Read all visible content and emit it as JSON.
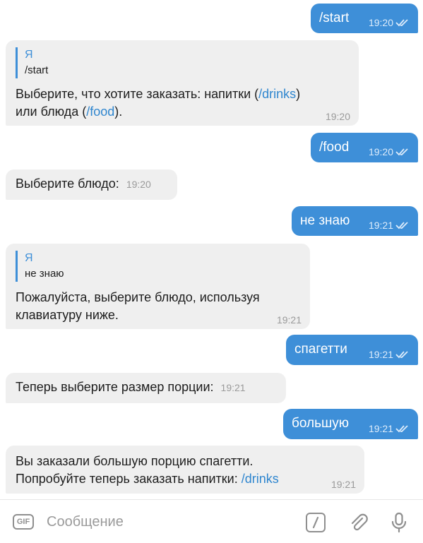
{
  "messages": [
    {
      "side": "out",
      "text": "/start",
      "time": "19:20"
    },
    {
      "side": "in",
      "reply_name": "Я",
      "reply_text": "/start",
      "text_a": "Выберите, что хотите заказать: напитки (",
      "cmd_a": "/drinks",
      "text_b": ")",
      "text_c": "или блюда (",
      "cmd_b": "/food",
      "text_d": ").",
      "time": "19:20"
    },
    {
      "side": "out",
      "text": "/food",
      "time": "19:20"
    },
    {
      "side": "in",
      "text": "Выберите блюдо:",
      "time": "19:20"
    },
    {
      "side": "out",
      "text": "не знаю",
      "time": "19:21"
    },
    {
      "side": "in",
      "reply_name": "Я",
      "reply_text": "не знаю",
      "line1": "Пожалуйста, выберите блюдо, используя",
      "line2": "клавиатуру ниже.",
      "time": "19:21"
    },
    {
      "side": "out",
      "text": "спагетти",
      "time": "19:21"
    },
    {
      "side": "in",
      "text": "Теперь выберите размер порции:",
      "time": "19:21"
    },
    {
      "side": "out",
      "text": "большую",
      "time": "19:21"
    },
    {
      "side": "in",
      "line1": "Вы заказали большую порцию спагетти.",
      "line2": "Попробуйте теперь заказать напитки: ",
      "cmd": "/drinks",
      "time": "19:21"
    }
  ],
  "input": {
    "placeholder": "Сообщение",
    "gif_label": "GIF"
  },
  "icons": {
    "gif": "gif-icon",
    "bot_command": "slash-command-icon",
    "attach": "paperclip-icon",
    "mic": "microphone-icon",
    "read": "double-check-icon"
  },
  "colors": {
    "accent": "#3e8fd8",
    "incoming": "#efefef",
    "link": "#2f86cf"
  }
}
